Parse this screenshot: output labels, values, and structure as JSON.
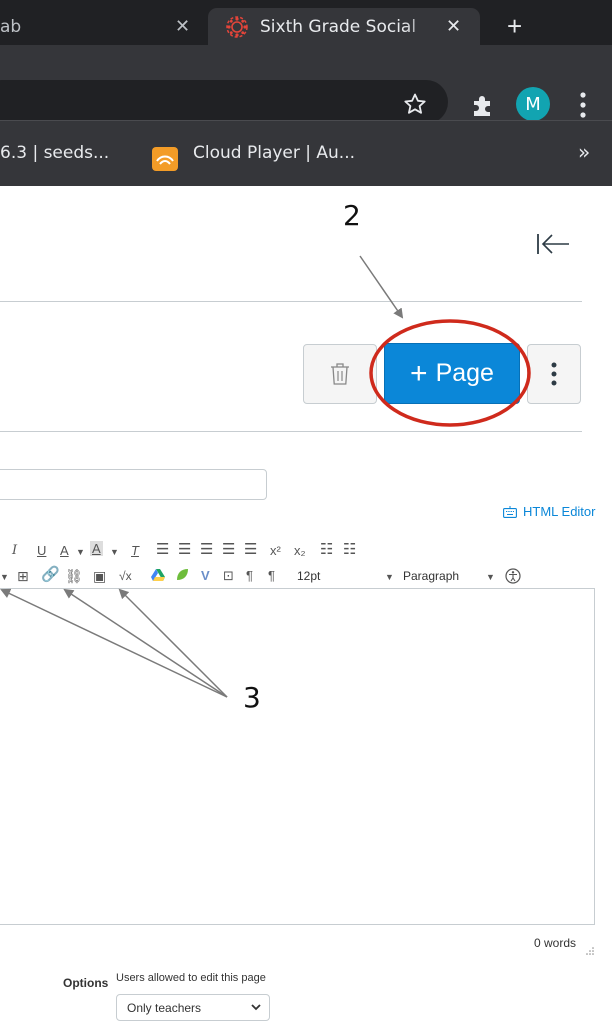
{
  "browser": {
    "tabs": [
      {
        "title": "ab",
        "active": false
      },
      {
        "title": "Sixth Grade Social",
        "active": true
      }
    ],
    "new_tab_label": "+",
    "avatar_letter": "M",
    "bookmarks": [
      {
        "label": "6.3 | seeds..."
      },
      {
        "label": "Cloud Player | Au..."
      }
    ],
    "bookmarks_overflow": "»",
    "colors": {
      "tabstrip": "#202124",
      "toolbar": "#35363a",
      "avatar": "#12a4b1"
    }
  },
  "page": {
    "page_button_label": "Page",
    "page_button_plus": "+",
    "html_editor_label": "HTML Editor",
    "word_count": "0 words",
    "options_label": "Options",
    "options_description": "Users allowed to edit this page",
    "options_selected": "Only teachers",
    "colors": {
      "primary": "#0b87d8",
      "border": "#c7cdd1"
    }
  },
  "editor_toolbar": {
    "font_size": "12pt",
    "block_format": "Paragraph"
  },
  "annotations": {
    "label_2": "2",
    "label_3": "3",
    "highlight_color": "#cf2a1c"
  }
}
